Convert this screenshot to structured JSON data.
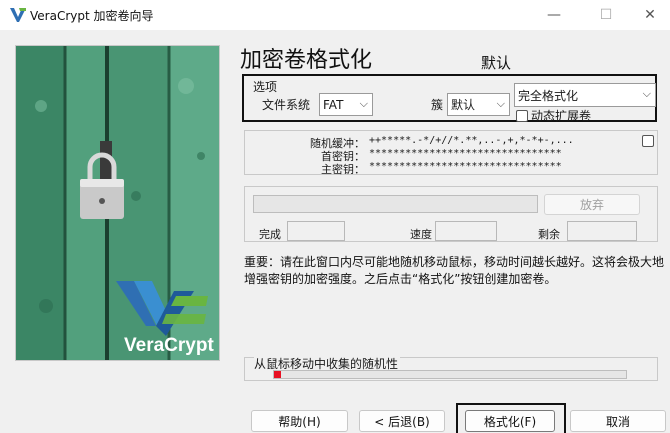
{
  "window": {
    "title": "VeraCrypt 加密卷向导",
    "minimize": "—",
    "maximize": "☐",
    "close": "✕"
  },
  "brand": {
    "name": "VeraCrypt",
    "logo_colors": [
      "#3a8fd1",
      "#2f6fb3",
      "#69b541"
    ]
  },
  "page": {
    "title": "加密卷格式化",
    "annotation": "默认"
  },
  "options": {
    "legend": "选项",
    "filesystem_label": "文件系统",
    "filesystem_value": "FAT",
    "cluster_label": "簇",
    "cluster_value": "默认",
    "format_mode_value": "完全格式化",
    "dynamic_label": "动态扩展卷",
    "dynamic_checked": false
  },
  "keys": {
    "random_pool_label": "随机缓冲：",
    "random_pool_value": "++*****.-*/+//*.**,..-,+,*-*+-,...",
    "header_key_label": "首密钥：",
    "header_key_value": "********************************",
    "master_key_label": "主密钥：",
    "master_key_value": "********************************",
    "show_checked": false
  },
  "progress": {
    "abort_label": "放弃",
    "done_label": "完成",
    "speed_label": "速度",
    "left_label": "剩余",
    "percent": 0
  },
  "note": "重要：请在此窗口内尽可能地随机移动鼠标，移动时间越长越好。这将会极大地增强密钥的加密强度。之后点击“格式化”按钮创建加密卷。",
  "randomness": {
    "label": "从鼠标移动中收集的随机性",
    "level": 0.02,
    "color": "#e81123"
  },
  "buttons": {
    "help": "帮助(H)",
    "back": "< 后退(B)",
    "format": "格式化(F)",
    "cancel": "取消"
  }
}
